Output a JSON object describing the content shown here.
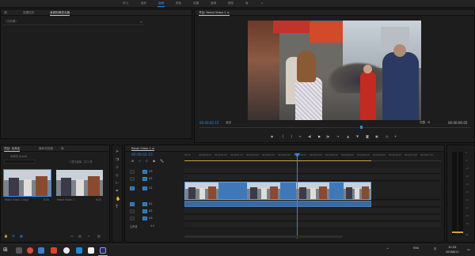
{
  "workspace_tabs": [
    "学习",
    "组件",
    "编辑",
    "颜色",
    "效果",
    "音频",
    "图形",
    "库",
    "»"
  ],
  "active_workspace": "编辑",
  "source_panel": {
    "tabs": [
      "源",
      "效果控件",
      "音频剪辑混合器"
    ],
    "active_tab": "音频剪辑混合器",
    "empty_text": "（无剪辑）"
  },
  "program_monitor": {
    "title": "节目: Retail Video 1 ≡",
    "timecode": "00:00:02:15",
    "fit": "适合",
    "scale": "完整",
    "duration": "00:00:06:05"
  },
  "project_panel": {
    "tabs": [
      "项目: 未命名",
      "媒体浏览器",
      "库"
    ],
    "project_name": "未命名.prproj",
    "count": "1 项已选择，共 2 项",
    "clips": [
      {
        "name": "Retail Video 1.mp4",
        "duration": "6:05"
      },
      {
        "name": "Retail Video 1",
        "duration": "6:05"
      }
    ]
  },
  "timeline": {
    "tab": "Retail Video 1 ≡",
    "timecode": "00:00:02:15",
    "ruler": [
      "00:00",
      "00:00:00:15",
      "00:00:01:00",
      "00:00:01:15",
      "00:00:02:00",
      "00:00:02:15",
      "00:00:03:00",
      "00:00:03:15",
      "00:00:04:00",
      "00:00:04:15",
      "00:00:05:00",
      "00:00:05:15",
      "00:00:06:00",
      "00:00:06:15",
      "00:00:07:00",
      "00:00:07:15"
    ],
    "video_tracks": [
      "V3",
      "V2",
      "V1"
    ],
    "audio_tracks": [
      "A1",
      "A2",
      "A3"
    ],
    "master": "主声道",
    "master_value": "0.0"
  },
  "meter_labels": [
    "0",
    "-6",
    "-12",
    "-18",
    "-24",
    "-30",
    "-36",
    "-42",
    "-48",
    "-54",
    "dB"
  ],
  "taskbar": {
    "time": "10:33",
    "date": "2019/6/11",
    "lang": "中",
    "wifi": "ENG"
  },
  "colors": {
    "accent": "#2d8ceb",
    "clip_video": "#3f78b8",
    "clip_audio": "#3a6aa0",
    "playhead": "#2d8ceb"
  }
}
